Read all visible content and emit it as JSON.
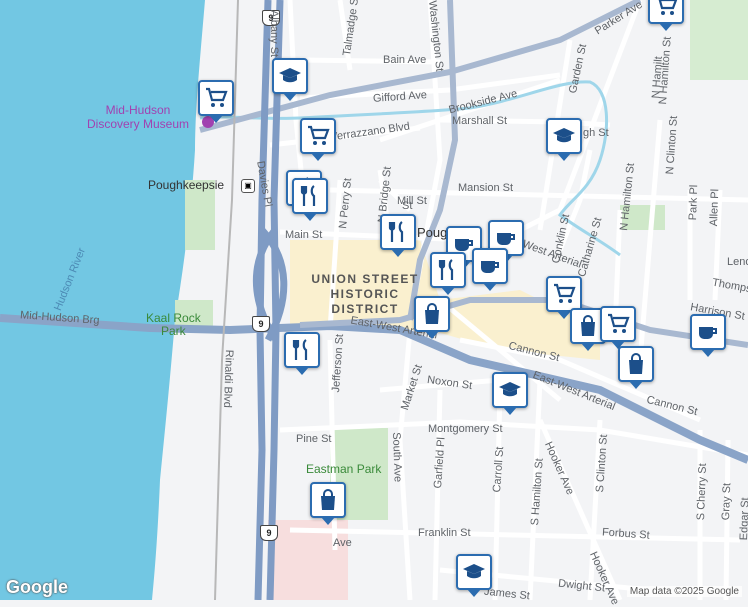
{
  "map": {
    "colors": {
      "water": "#72c7e3",
      "land": "#f3f4f6",
      "highway": "#8aa4c8",
      "arterial": "#a8b8d0",
      "park": "#cfe8c9",
      "district": "#faefc8",
      "pin": "#2b6cb0"
    },
    "place_labels": {
      "city": "Poughkeepsie",
      "district_line1": "UNION STREET",
      "district_line2": "HISTORIC",
      "district_line3": "DISTRICT",
      "museum_line1": "Mid-Hudson",
      "museum_line2": "Discovery Museum",
      "river": "Hudson River",
      "park1_line1": "Kaal Rock",
      "park1_line2": "Park",
      "park2": "Eastman Park",
      "pough_partial": "Pough"
    },
    "streets": {
      "albany": "Albany St",
      "talmadge": "Talmadge St",
      "bain": "Bain Ave",
      "gifford": "Gifford Ave",
      "brookside": "Brookside Ave",
      "verrazzano": "Verrazzano Blvd",
      "marshall": "Marshall St",
      "mansion": "Mansion St",
      "mill": "Mill St",
      "main": "Main St",
      "davies": "Davies Pl",
      "nperry": "N Perry St",
      "nbridge": "N Bridge St",
      "washington": "Washington St",
      "parker": "Parker Ave",
      "garden": "Garden St",
      "conklin": "Conklin St",
      "catharine": "Catharine St",
      "nhamilton": "N Hamilton St",
      "nhamilton2": "N Hamilton St",
      "nclinton": "N Clinton St",
      "parkpl": "Park Pl",
      "allenpl": "Allen Pl",
      "thompson": "Thomps",
      "harrison": "Harrison St",
      "lenox": "Leno",
      "midhudsonbrg": "Mid-Hudson Brg",
      "eastwest1": "East-West Arterial",
      "eastwest2": "East-West Arterial",
      "eastwest3": "East-West Arterial",
      "cannon1": "Cannon St",
      "cannon2": "Cannon St",
      "noxon": "Noxon St",
      "market": "Market St",
      "jefferson": "Jefferson St",
      "rinaldi": "Rinaldi Blvd",
      "montgomery": "Montgomery St",
      "pine": "Pine St",
      "southave": "South Ave",
      "garfield": "Garfield Pl",
      "carroll": "Carroll St",
      "hooker1": "Hooker Ave",
      "hooker2": "Hooker Ave",
      "shamilton": "S Hamilton St",
      "sclinton": "S Clinton St",
      "scherry": "S Cherry St",
      "gray": "Gray St",
      "edgar": "Edgar St",
      "forbus": "Forbus St",
      "franklin": "Franklin St",
      "dwight": "Dwight St",
      "james": "James St",
      "hamilton_top": "N Hamilt",
      "ave": "Ave",
      "gh": "gh St",
      "st_e": "St",
      "market_partial": "East"
    },
    "route_shields": [
      "9",
      "9",
      "9"
    ],
    "pins": [
      {
        "icon": "cart-icon"
      },
      {
        "icon": "school-icon"
      },
      {
        "icon": "cart-icon"
      },
      {
        "icon": "restaurant-icon"
      },
      {
        "icon": "restaurant-icon"
      },
      {
        "icon": "cafe-icon"
      },
      {
        "icon": "restaurant-icon"
      },
      {
        "icon": "cafe-icon"
      },
      {
        "icon": "shopping-bag-icon"
      },
      {
        "icon": "cart-icon"
      },
      {
        "icon": "school-icon"
      },
      {
        "icon": "shopping-bag-icon"
      },
      {
        "icon": "cart-icon"
      },
      {
        "icon": "shopping-bag-icon"
      },
      {
        "icon": "cafe-icon"
      },
      {
        "icon": "restaurant-icon"
      },
      {
        "icon": "school-icon"
      },
      {
        "icon": "shopping-bag-icon"
      },
      {
        "icon": "school-icon"
      },
      {
        "icon": "cart-icon"
      },
      {
        "icon": "shopping-bag-icon"
      }
    ],
    "attribution": {
      "logo": "Google",
      "data": "Map data ©2025 Google"
    }
  }
}
